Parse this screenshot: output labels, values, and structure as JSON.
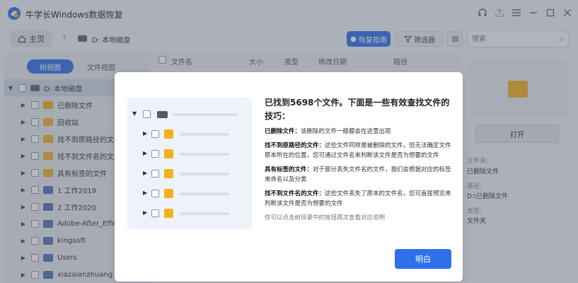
{
  "app": {
    "title": "牛学长Windows数据恢复",
    "brand_color": "#2f6fea"
  },
  "toolbar": {
    "home_label": "主页",
    "breadcrumb": "D: 本地磁盘",
    "guide_label": "恢复指南",
    "filter_label": "筛选器",
    "search_placeholder": "搜索"
  },
  "left_panel": {
    "view_tabs": [
      "树视图",
      "文件视图"
    ],
    "active_tab": "树视图",
    "tree": [
      {
        "label": "D: 本地磁盘",
        "icon": "disk-icon",
        "expanded": true,
        "level": 0
      },
      {
        "label": "已删除文件",
        "icon": "deleted-folder-icon",
        "level": 1
      },
      {
        "label": "回收站",
        "icon": "recycle-bin-icon",
        "level": 1
      },
      {
        "label": "找不到原路径的文件",
        "icon": "folder-icon",
        "level": 1
      },
      {
        "label": "找不到文件名的文件",
        "icon": "folder-icon",
        "level": 1
      },
      {
        "label": "具有标签的文件",
        "icon": "folder-icon",
        "level": 1
      },
      {
        "label": "1 工作2019",
        "icon": "folder-icon",
        "level": 1
      },
      {
        "label": "2 工作2020",
        "icon": "folder-icon",
        "level": 1
      },
      {
        "label": "Adobe-After_Effect",
        "icon": "folder-icon",
        "level": 1
      },
      {
        "label": "kingsoft",
        "icon": "folder-icon",
        "level": 1
      },
      {
        "label": "Users",
        "icon": "folder-icon",
        "level": 1
      },
      {
        "label": "xiazaianzhuang",
        "icon": "folder-icon",
        "level": 1
      }
    ]
  },
  "list": {
    "columns": [
      "文件名",
      "大小",
      "类型",
      "修改日期",
      "路径"
    ]
  },
  "right_panel": {
    "open_label": "打开",
    "folder_key": "文件夹:",
    "folder_val": "已删除文件",
    "path_key": "路径:",
    "path_val": "D:\\已删除文件",
    "type_key": "类型:",
    "type_val": "文件夹"
  },
  "dialog": {
    "title": "已找到5698个文件。下面是一些有效查找文件的技巧：",
    "tips": [
      {
        "label": "已删除文件：",
        "text": "该删除的文件一般都会在这里出现"
      },
      {
        "label": "找不到原路径的文件：",
        "text": "这些文件同样是被删除的文件，但无法确定文件原本所在的位置，您可通过文件名来判断该文件是否为想要的文件"
      },
      {
        "label": "具有标签的文件：",
        "text": "对于部分丢失文件名的文件，我们会根据对应的标签来命名以及分类"
      },
      {
        "label": "找不到文件名的文件：",
        "text": "这些文件丢失了原本的文件名，您可直接预览来判断该文件是否为想要的文件"
      }
    ],
    "hint": "你可以点击树目录中的按钮再次查看对应说明",
    "ok_label": "明白"
  }
}
